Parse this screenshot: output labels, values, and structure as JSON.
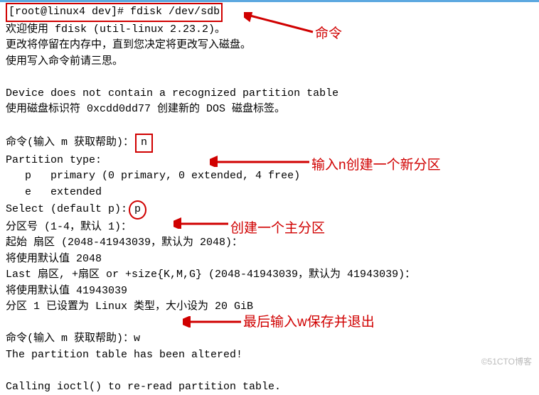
{
  "terminal": {
    "prompt": "[root@linux4 dev]#",
    "command": "fdisk /dev/sdb",
    "welcome": "欢迎使用 fdisk (util-linux 2.23.2)。",
    "blank": "",
    "change_notice": "更改将停留在内存中，直到您决定将更改写入磁盘。",
    "think": "使用写入命令前请三思。",
    "no_table": "Device does not contain a recognized partition table",
    "dos_label": "使用磁盘标识符 0xcdd0dd77 创建新的 DOS 磁盘标签。",
    "cmd_prompt1_a": "命令(输入 m 获取帮助)：",
    "input_n": "n",
    "ptype": "Partition type:",
    "ptype_p": "   p   primary (0 primary, 0 extended, 4 free)",
    "ptype_e": "   e   extended",
    "select_p_a": "Select (default p):",
    "input_p": "p",
    "part_num": "分区号 (1-4，默认 1)：",
    "start_sector": "起始 扇区 (2048-41943039，默认为 2048)：",
    "use_default1": "将使用默认值 2048",
    "last_sector": "Last 扇区, +扇区 or +size{K,M,G} (2048-41943039，默认为 41943039)：",
    "use_default2": "将使用默认值 41943039",
    "set_type": "分区 1 已设置为 Linux 类型，大小设为 20 GiB",
    "cmd_prompt2": "命令(输入 m 获取帮助)：w",
    "altered": "The partition table has been altered!",
    "ioctl": "Calling ioctl() to re-read partition table."
  },
  "annotations": {
    "anno_cmd": "命令",
    "anno_n": "输入n创建一个新分区",
    "anno_p": "创建一个主分区",
    "anno_w": "最后输入w保存并退出"
  },
  "watermark": "©51CTO博客"
}
